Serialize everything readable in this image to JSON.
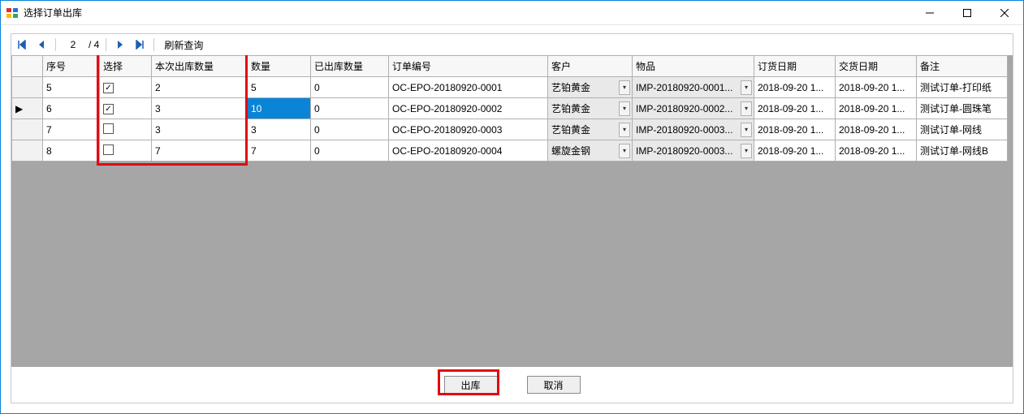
{
  "window": {
    "title": "选择订单出库"
  },
  "toolbar": {
    "current_page": "2",
    "total_pages_label": "/ 4",
    "refresh_label": "刷新查询"
  },
  "columns": {
    "seq": "序号",
    "select": "选择",
    "out_qty": "本次出库数量",
    "qty": "数量",
    "shipped": "已出库数量",
    "order_no": "订单编号",
    "customer": "客户",
    "item": "物品",
    "order_date": "订货日期",
    "delivery_date": "交货日期",
    "remark": "备注"
  },
  "rows": [
    {
      "indicator": "",
      "seq": "5",
      "checked": true,
      "out_qty": "2",
      "qty": "5",
      "shipped": "0",
      "order_no": "OC-EPO-20180920-0001",
      "customer": "艺铂黄金",
      "item": "IMP-20180920-0001...",
      "order_date": "2018-09-20 1...",
      "delivery_date": "2018-09-20 1...",
      "remark": "测试订单-打印纸",
      "qty_selected": false
    },
    {
      "indicator": "▶",
      "seq": "6",
      "checked": true,
      "out_qty": "3",
      "qty": "10",
      "shipped": "0",
      "order_no": "OC-EPO-20180920-0002",
      "customer": "艺铂黄金",
      "item": "IMP-20180920-0002...",
      "order_date": "2018-09-20 1...",
      "delivery_date": "2018-09-20 1...",
      "remark": "测试订单-圆珠笔",
      "qty_selected": true
    },
    {
      "indicator": "",
      "seq": "7",
      "checked": false,
      "out_qty": "3",
      "qty": "3",
      "shipped": "0",
      "order_no": "OC-EPO-20180920-0003",
      "customer": "艺铂黄金",
      "item": "IMP-20180920-0003...",
      "order_date": "2018-09-20 1...",
      "delivery_date": "2018-09-20 1...",
      "remark": "测试订单-网线",
      "qty_selected": false
    },
    {
      "indicator": "",
      "seq": "8",
      "checked": false,
      "out_qty": "7",
      "qty": "7",
      "shipped": "0",
      "order_no": "OC-EPO-20180920-0004",
      "customer": "螺旋金钢",
      "item": "IMP-20180920-0003...",
      "order_date": "2018-09-20 1...",
      "delivery_date": "2018-09-20 1...",
      "remark": "测试订单-网线B",
      "qty_selected": false
    }
  ],
  "footer": {
    "submit_label": "出库",
    "cancel_label": "取消"
  },
  "colwidths": {
    "rowhead": 38,
    "seq": 70,
    "select": 64,
    "out_qty": 118,
    "qty": 78,
    "shipped": 96,
    "order_no": 196,
    "customer": 104,
    "item": 150,
    "order_date": 100,
    "delivery_date": 100,
    "remark": 112
  }
}
